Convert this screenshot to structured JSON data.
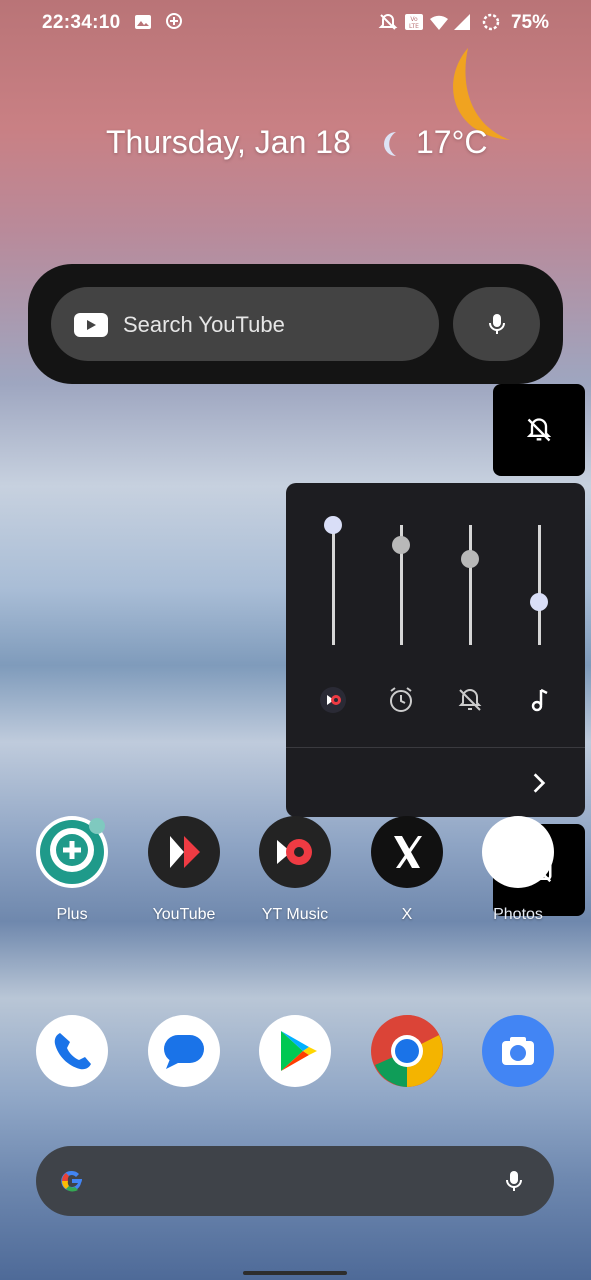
{
  "status_bar": {
    "time": "22:34:10",
    "battery": "75%",
    "icons": [
      "image-icon",
      "location-plus-icon",
      "bell-off-icon",
      "volte-icon",
      "wifi-icon",
      "signal-icon",
      "battery-saver-icon"
    ]
  },
  "home": {
    "date": "Thursday, Jan 18",
    "weather_icon": "moon-icon",
    "temperature": "17°C"
  },
  "youtube_widget": {
    "placeholder": "Search YouTube",
    "accent": "#ffffff"
  },
  "volume_panel": {
    "ringer_button_icon": "bell-off-icon",
    "streams": [
      {
        "name": "youtube-music-icon",
        "level": 1.0
      },
      {
        "name": "alarm-icon",
        "level": 0.83
      },
      {
        "name": "notification-off-icon",
        "level": 0.72
      },
      {
        "name": "music-note-icon",
        "level": 0.36
      }
    ],
    "expand_icon": "chevron-right-icon",
    "caption_button_icon": "captions-off-icon"
  },
  "apps": [
    {
      "label": "Plus",
      "icon": "plus-icon"
    },
    {
      "label": "YouTube",
      "icon": "youtube-icon"
    },
    {
      "label": "YT Music",
      "icon": "yt-music-icon"
    },
    {
      "label": "X",
      "icon": "x-icon"
    },
    {
      "label": "Photos",
      "icon": "photos-icon"
    }
  ],
  "dock": [
    {
      "icon": "phone-icon"
    },
    {
      "icon": "messages-icon"
    },
    {
      "icon": "play-store-icon"
    },
    {
      "icon": "chrome-icon"
    },
    {
      "icon": "camera-icon"
    }
  ],
  "search_bar": {
    "logo": "google-logo",
    "mic": "mic-icon"
  }
}
